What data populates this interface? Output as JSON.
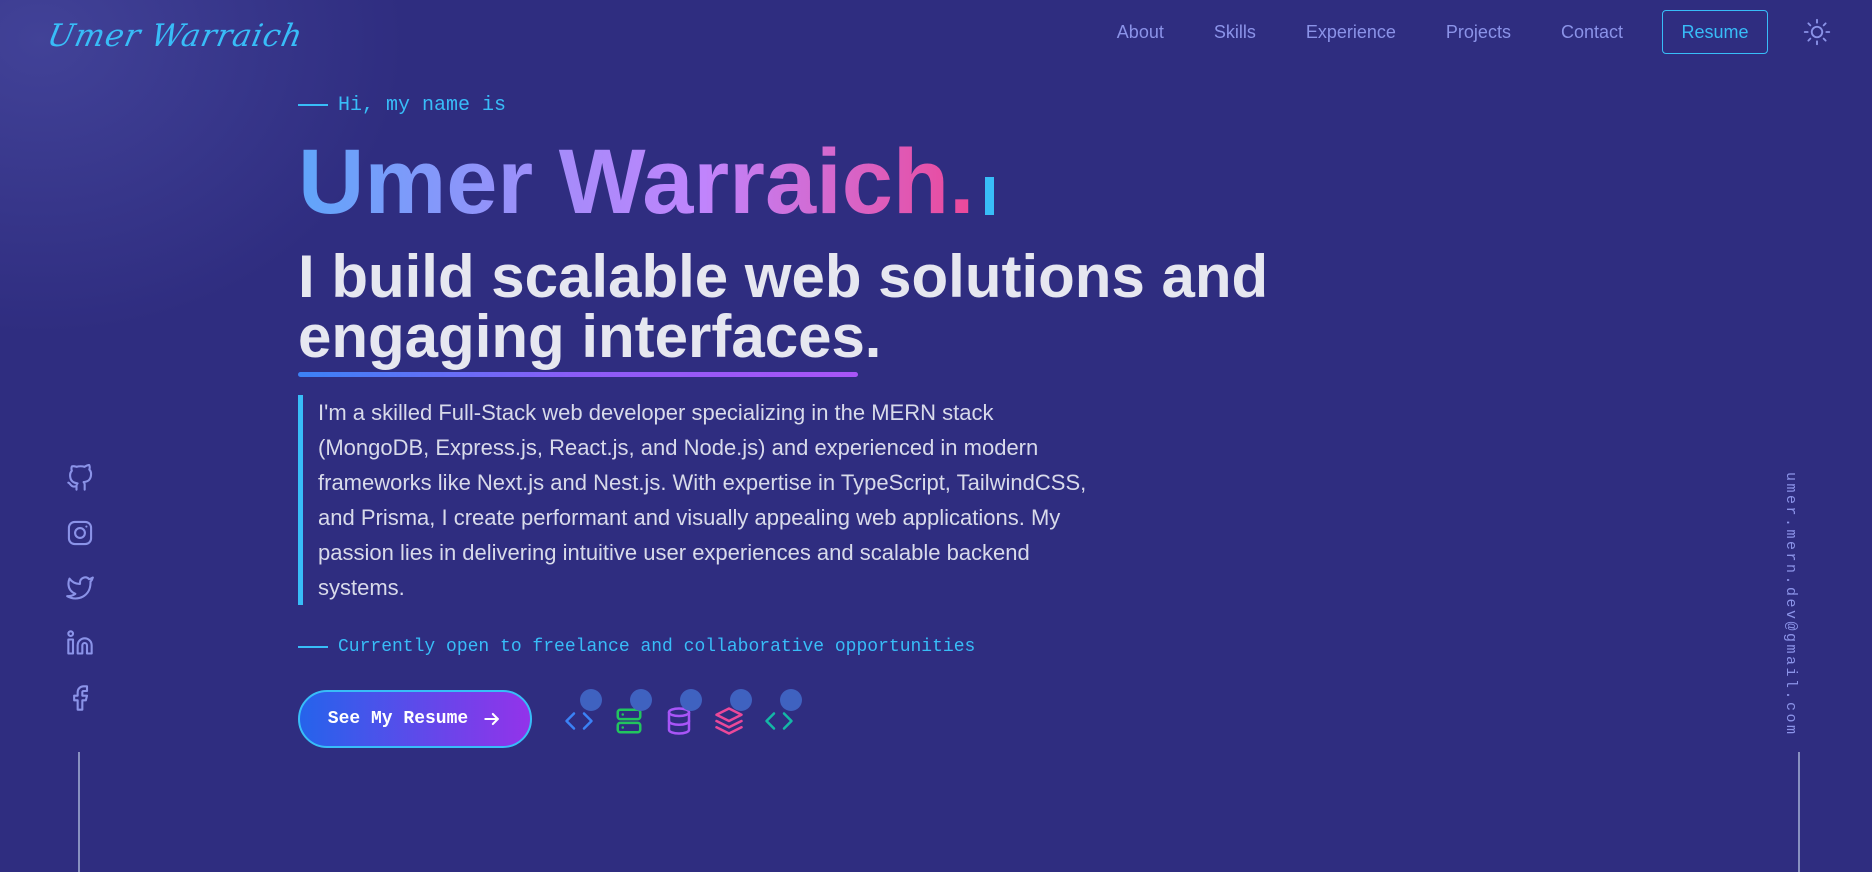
{
  "header": {
    "logo": "Umer Warraich",
    "nav": [
      "About",
      "Skills",
      "Experience",
      "Projects",
      "Contact"
    ],
    "resume_label": "Resume",
    "theme_icon": "sun-icon"
  },
  "hero": {
    "greeting": "Hi, my name is",
    "name": "Umer Warraich.",
    "tagline_line1": "I build scalable web solutions and",
    "tagline_line2": "engaging interfaces.",
    "about": "I'm a skilled Full-Stack web developer specializing in the MERN stack (MongoDB, Express.js, React.js, and Node.js) and experienced in modern frameworks like Next.js and Nest.js. With expertise in TypeScript, TailwindCSS, and Prisma, I create performant and visually appealing web applications. My passion lies in delivering intuitive user experiences and scalable backend systems.",
    "availability": "Currently open to freelance and collaborative opportunities",
    "cta_label": "See My Resume"
  },
  "tech_icons": [
    {
      "name": "code-icon",
      "color": "#3b82f6"
    },
    {
      "name": "server-icon",
      "color": "#22c55e"
    },
    {
      "name": "database-icon",
      "color": "#a855f7"
    },
    {
      "name": "layers-icon",
      "color": "#ec4899"
    },
    {
      "name": "code-icon",
      "color": "#14b8a6"
    }
  ],
  "socials": [
    "github-icon",
    "instagram-icon",
    "twitter-icon",
    "linkedin-icon",
    "facebook-icon"
  ],
  "email": "umer.mern.dev@gmail.com",
  "colors": {
    "background": "#2f2d80",
    "accent": "#38bdf8",
    "nav_link": "#8b93e8",
    "text": "#e6e7f0"
  }
}
